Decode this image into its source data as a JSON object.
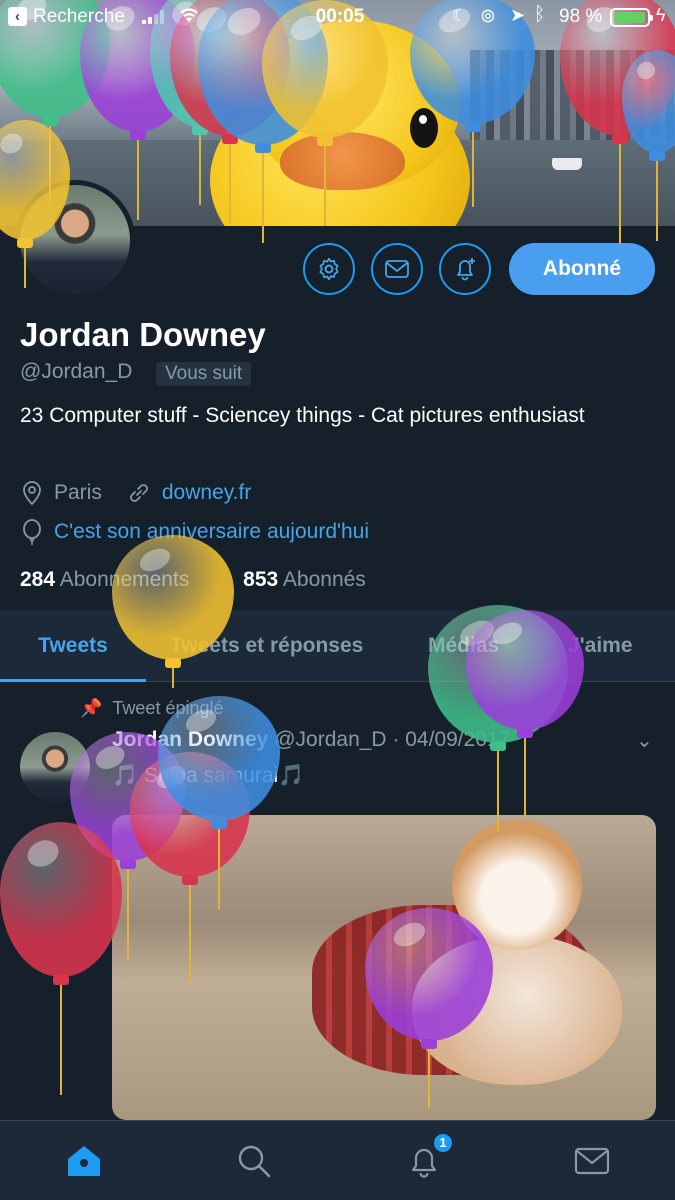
{
  "status_bar": {
    "back_label": "Recherche",
    "time": "00:05",
    "battery": "98 %"
  },
  "profile": {
    "name": "Jordan Downey",
    "handle": "@Jordan_D",
    "follows_you": "Vous suit",
    "bio": "23 Computer stuff - Sciencey things - Cat pictures enthusiast",
    "location": "Paris",
    "website": "downey.fr",
    "birthday": "C'est son anniversaire aujourd'hui",
    "following_count": "284",
    "following_label": "Abonnements",
    "followers_count": "853",
    "followers_label": "Abonnés",
    "follow_button": "Abonné"
  },
  "tabs": [
    {
      "label": "Tweets",
      "active": true
    },
    {
      "label": "Tweets et réponses",
      "active": false
    },
    {
      "label": "Médias",
      "active": false
    },
    {
      "label": "J'aime",
      "active": false
    }
  ],
  "tweet": {
    "pinned_label": "Tweet épinglé",
    "author": "Jordan Downey",
    "handle_date": "@Jordan_D · 04/09/2017",
    "text": "🎵 Shiba samurai🎵"
  },
  "nav": {
    "notification_count": "1"
  },
  "colors": {
    "accent": "#1d9bf0",
    "background": "#15202b",
    "muted": "#8899a6"
  }
}
